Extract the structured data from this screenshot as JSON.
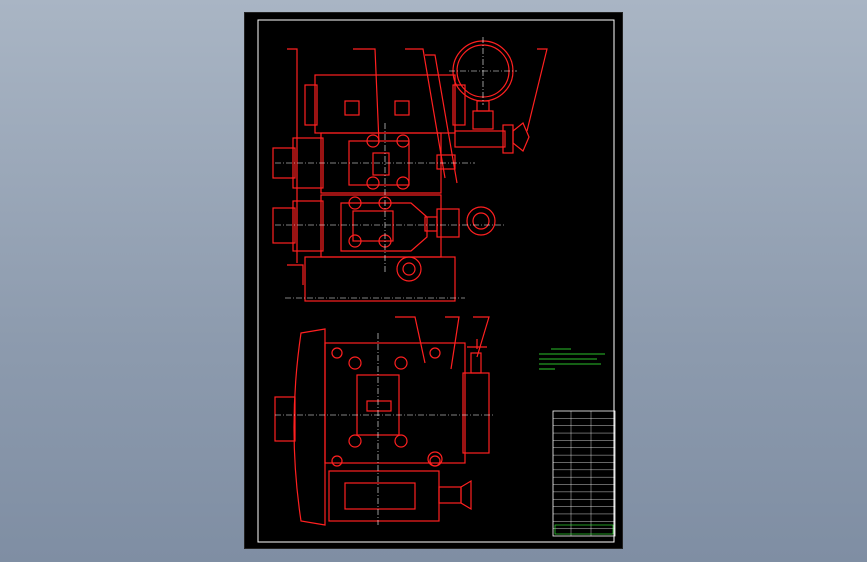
{
  "drawing": {
    "background": "#000000",
    "line_color": "#ff2020",
    "frame_color": "#ffffff",
    "notes_color": "#39ff39",
    "note_lines": [
      "",
      "",
      "",
      "",
      ""
    ],
    "title_block_rows": [
      "",
      "",
      "",
      "",
      "",
      "",
      "",
      "",
      "",
      "",
      "",
      "",
      "",
      "",
      "",
      "",
      ""
    ]
  }
}
